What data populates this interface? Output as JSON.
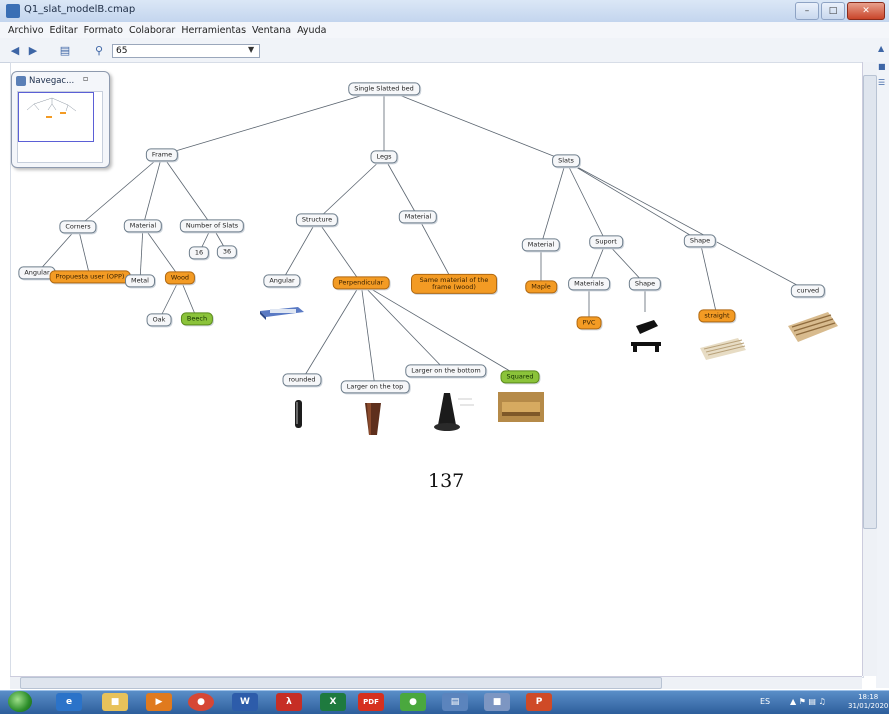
{
  "window": {
    "title": "Q1_slat_modelB.cmap"
  },
  "menu": [
    "Archivo",
    "Editar",
    "Formato",
    "Colaborar",
    "Herramientas",
    "Ventana",
    "Ayuda"
  ],
  "toolbar": {
    "zoom_value": "65"
  },
  "navigator": {
    "title": "Navegac..."
  },
  "page_number": "137",
  "nodes": {
    "root": "Single Slatted bed",
    "frame": "Frame",
    "legs": "Legs",
    "slats": "Slats",
    "corners": "Corners",
    "frame_material": "Material",
    "number_of_slats": "Number of Slats",
    "angular": "Angular",
    "proposals": "Propuesta user (OPP)",
    "metal": "Metal",
    "wood": "Wood",
    "n16": "16",
    "n36": "36",
    "oak": "Oak",
    "beech": "Beech",
    "structure": "Structure",
    "legs_material": "Material",
    "regular": "Angular",
    "perpendicular": "Perpendicular",
    "same_material": "Same material of the frame (wood)",
    "slats_material": "Material",
    "maple": "Maple",
    "support": "Suport",
    "shape": "Shape",
    "materials": "Materials",
    "support_shape": "Shape",
    "pvc": "PVC",
    "straight": "straight",
    "curved": "curved",
    "rounded": "rounded",
    "larger_top": "Larger on the top",
    "larger_bottom": "Larger on the bottom",
    "squared": "Squared"
  },
  "taskbar": {
    "word": "W",
    "excel": "X",
    "pdf": "PDF",
    "ppt": "P",
    "lang": "ES",
    "time": "18:18",
    "date": "31/01/2020"
  },
  "colors": {
    "orange": "#f39b24",
    "green": "#8bc33a",
    "title": "#c3d5ee"
  }
}
